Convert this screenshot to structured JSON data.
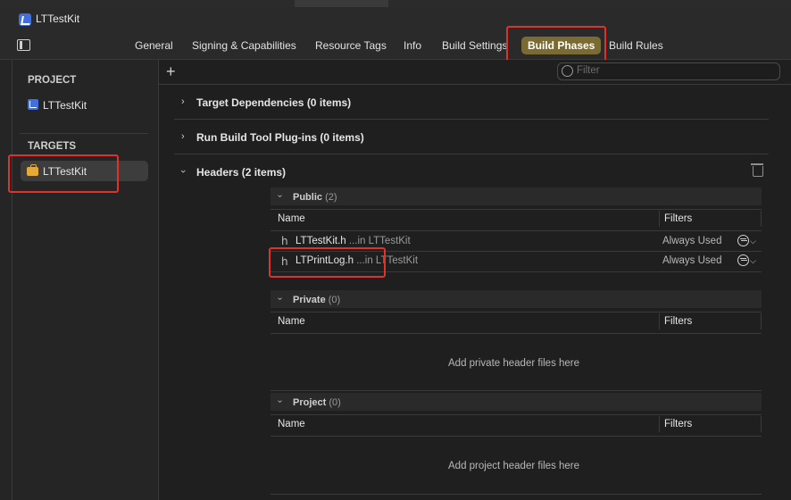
{
  "window": {
    "title": "LTTestKit"
  },
  "tabs": [
    "General",
    "Signing & Capabilities",
    "Resource Tags",
    "Info",
    "Build Settings",
    "Build Phases",
    "Build Rules"
  ],
  "active_tab": "Build Phases",
  "sidebar": {
    "project_heading": "PROJECT",
    "project_item": "LTTestKit",
    "targets_heading": "TARGETS",
    "target_item": "LTTestKit"
  },
  "toolbar": {
    "add_label": "+",
    "filter_placeholder": "Filter"
  },
  "sections": {
    "target_dependencies": "Target Dependencies (0 items)",
    "run_build_tool": "Run Build Tool Plug-ins (0 items)",
    "headers": "Headers (2 items)"
  },
  "headers": {
    "public": {
      "label": "Public",
      "count": "(2)"
    },
    "private": {
      "label": "Private",
      "count": "(0)",
      "empty_text": "Add private header files here"
    },
    "project": {
      "label": "Project",
      "count": "(0)",
      "empty_text": "Add project header files here"
    },
    "col_name": "Name",
    "col_filters": "Filters",
    "public_rows": [
      {
        "file": "LTTestKit.h",
        "location": "...in LTTestKit",
        "filter": "Always Used"
      },
      {
        "file": "LTPrintLog.h",
        "location": "...in LTTestKit",
        "filter": "Always Used"
      }
    ]
  },
  "colors": {
    "highlight": "#e0312b",
    "active_tab_bg": "#7a6a33",
    "project_icon": "#3f6fe0",
    "target_icon": "#e7a936"
  },
  "icons": [
    "sidebar-toggle-icon",
    "project-icon",
    "target-icon",
    "filter-icon",
    "trash-icon",
    "header-file-icon",
    "chevron-right-icon",
    "chevron-down-icon"
  ]
}
